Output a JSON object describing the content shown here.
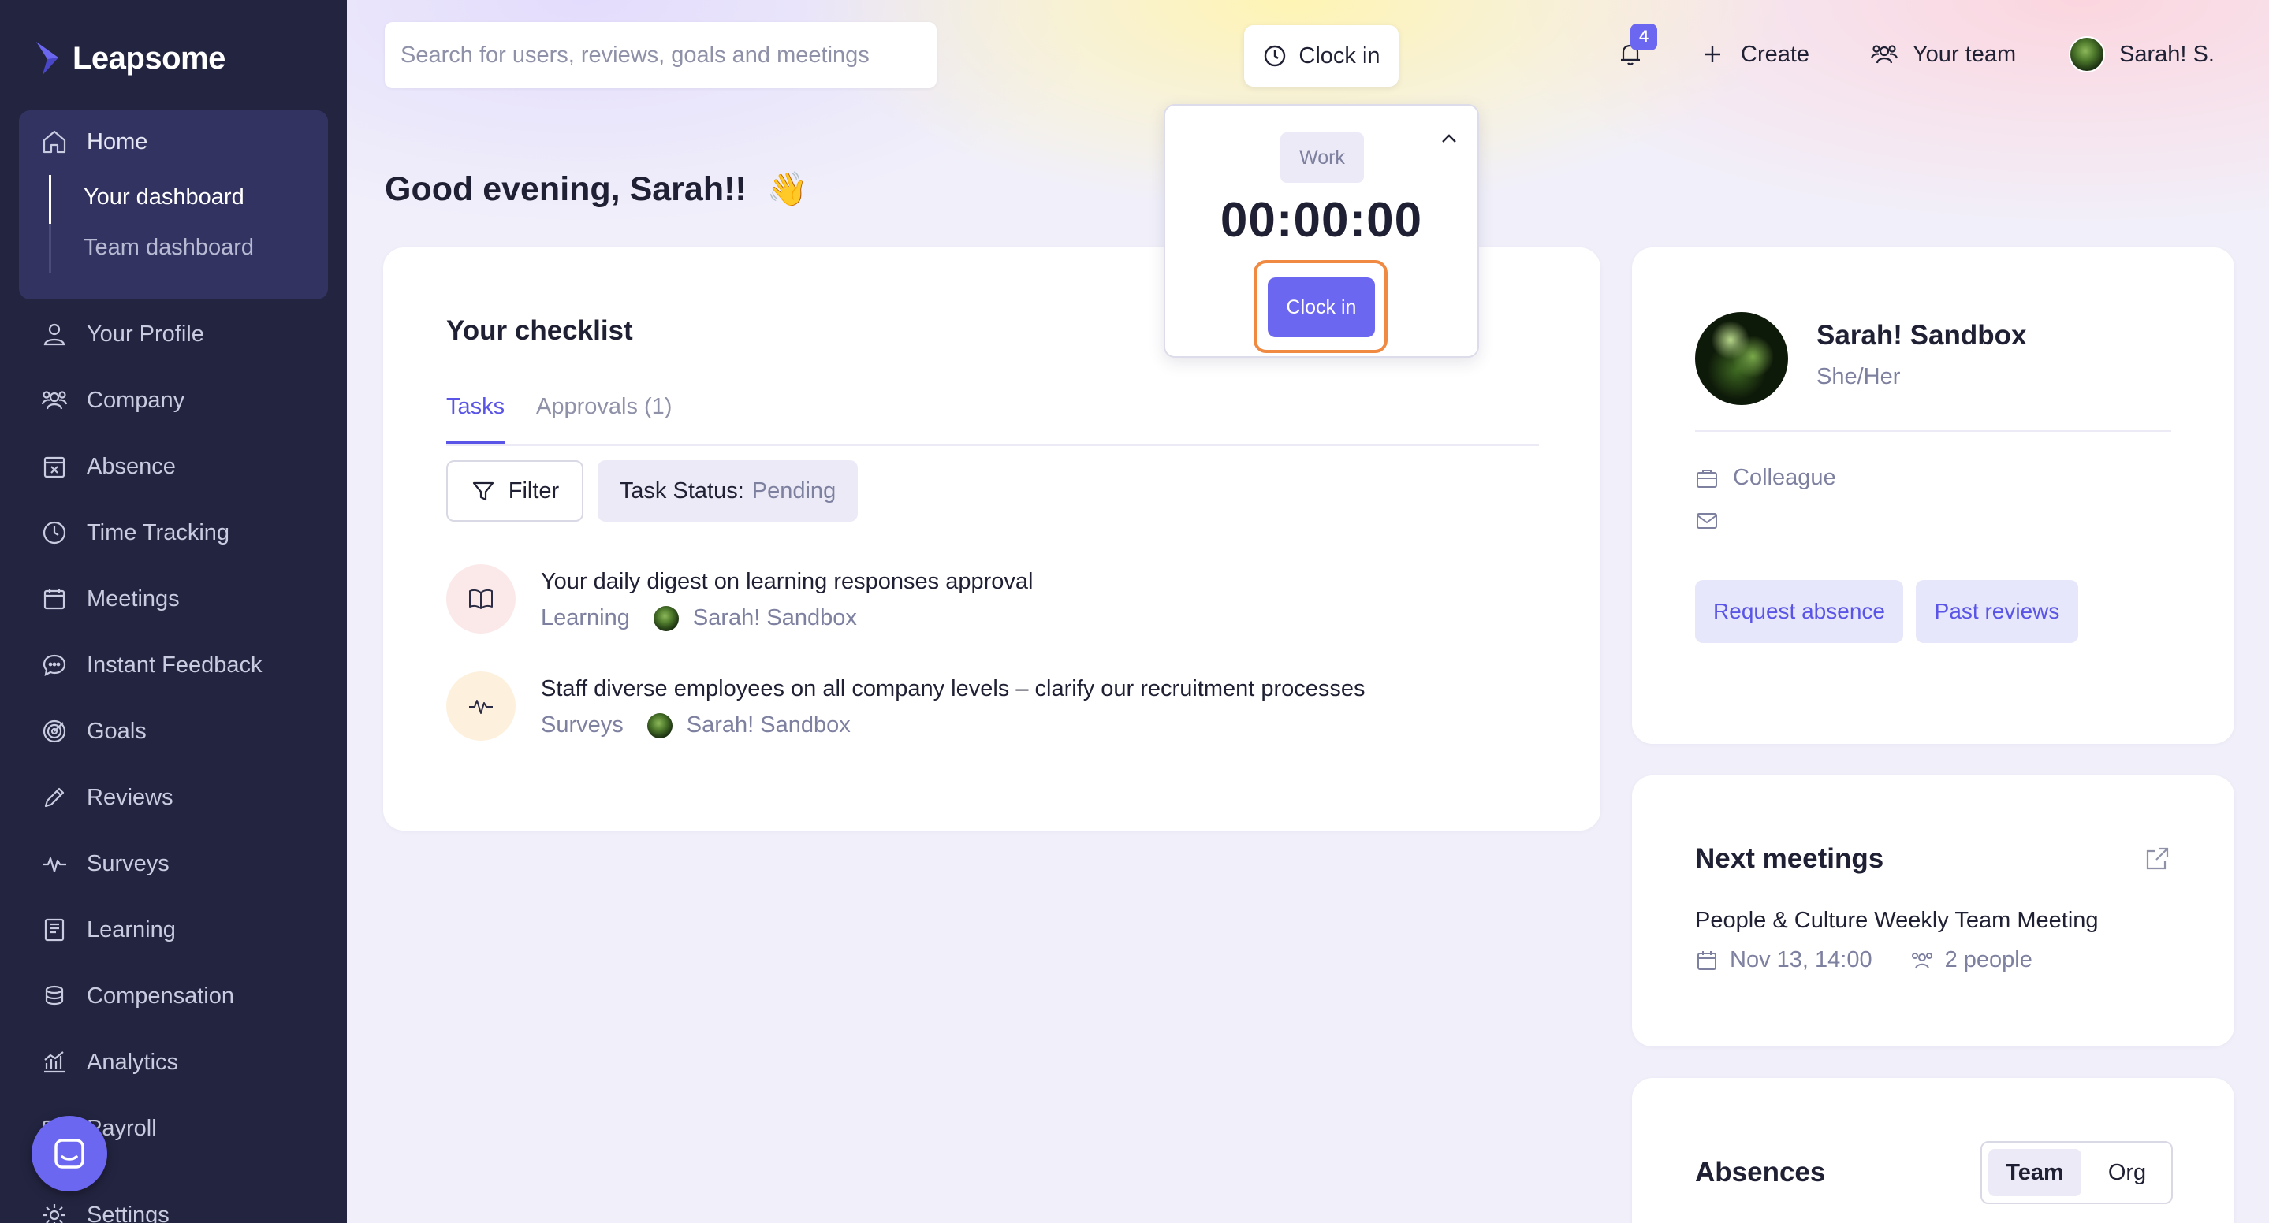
{
  "app": {
    "name": "Leapsome",
    "brand_color": "#6b67f0",
    "sidebar_color": "#232440",
    "highlight_color": "#f08a42"
  },
  "search": {
    "placeholder": "Search for users, reviews, goals and meetings"
  },
  "topbar": {
    "clock_in_label": "Clock in",
    "notifications_count": "4",
    "create_label": "Create",
    "your_team_label": "Your team",
    "user_label": "Sarah! S."
  },
  "sidebar": {
    "home": {
      "label": "Home",
      "icon": "home-icon"
    },
    "home_sub": [
      {
        "label": "Your dashboard",
        "active": true
      },
      {
        "label": "Team dashboard",
        "active": false
      }
    ],
    "items": [
      {
        "label": "Your Profile",
        "icon": "user-icon"
      },
      {
        "label": "Company",
        "icon": "people-icon"
      },
      {
        "label": "Absence",
        "icon": "absence-icon"
      },
      {
        "label": "Time Tracking",
        "icon": "clock-icon"
      },
      {
        "label": "Meetings",
        "icon": "calendar-icon"
      },
      {
        "label": "Instant Feedback",
        "icon": "chat-icon"
      },
      {
        "label": "Goals",
        "icon": "target-icon"
      },
      {
        "label": "Reviews",
        "icon": "pencil-icon"
      },
      {
        "label": "Surveys",
        "icon": "pulse-icon"
      },
      {
        "label": "Learning",
        "icon": "book-icon"
      },
      {
        "label": "Compensation",
        "icon": "coins-icon"
      },
      {
        "label": "Analytics",
        "icon": "analytics-icon"
      },
      {
        "label": "Payroll",
        "icon": "payroll-icon"
      },
      {
        "label": "Settings",
        "icon": "gear-icon"
      }
    ]
  },
  "greeting": {
    "text": "Good evening, Sarah!!",
    "emoji": "👋"
  },
  "checklist": {
    "title": "Your checklist",
    "tabs": [
      {
        "label": "Tasks",
        "active": true
      },
      {
        "label": "Approvals (1)",
        "active": false
      }
    ],
    "filter_label": "Filter",
    "status_label": "Task Status:",
    "status_value": "Pending",
    "tasks": [
      {
        "title": "Your daily digest on learning responses approval",
        "category": "Learning",
        "person": "Sarah! Sandbox",
        "icon": "book-open-icon"
      },
      {
        "title": "Staff diverse employees on all company levels – clarify our recruitment processes",
        "category": "Surveys",
        "person": "Sarah! Sandbox",
        "icon": "pulse-icon"
      }
    ]
  },
  "clock_popup": {
    "type_label": "Work",
    "timer": "00:00:00",
    "button_label": "Clock in"
  },
  "profile": {
    "name": "Sarah! Sandbox",
    "pronouns": "She/Her",
    "role": "Colleague",
    "request_absence_label": "Request absence",
    "past_reviews_label": "Past reviews"
  },
  "meetings": {
    "title": "Next meetings",
    "items": [
      {
        "title": "People & Culture Weekly Team Meeting",
        "date": "Nov 13, 14:00",
        "attendees": "2 people"
      }
    ]
  },
  "absences": {
    "title": "Absences",
    "toggle": [
      {
        "label": "Team",
        "active": true
      },
      {
        "label": "Org",
        "active": false
      }
    ]
  }
}
